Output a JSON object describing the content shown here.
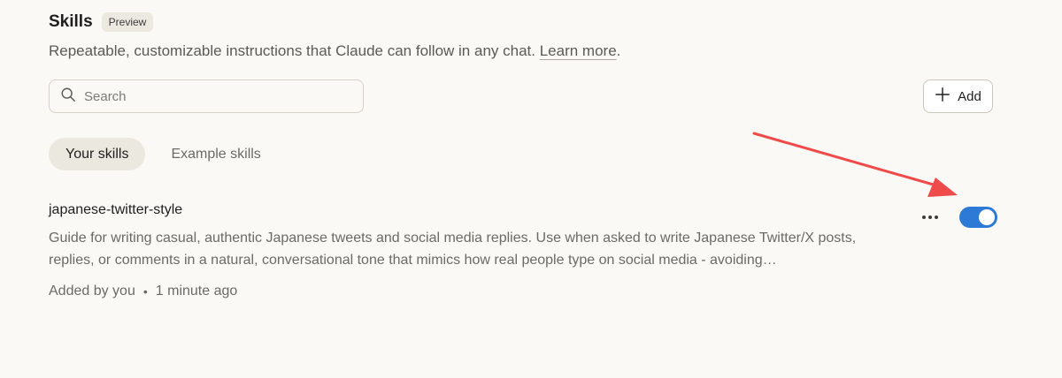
{
  "header": {
    "title": "Skills",
    "badge": "Preview",
    "subtitle": "Repeatable, customizable instructions that Claude can follow in any chat.",
    "learn_more": "Learn more",
    "subtitle_suffix": "."
  },
  "search": {
    "placeholder": "Search",
    "value": ""
  },
  "add_button": {
    "label": "Add",
    "icon": "plus-icon"
  },
  "tabs": [
    {
      "label": "Your skills",
      "active": true
    },
    {
      "label": "Example skills",
      "active": false
    }
  ],
  "skills": [
    {
      "name": "japanese-twitter-style",
      "description": "Guide for writing casual, authentic Japanese tweets and social media replies. Use when asked to write Japanese Twitter/X posts, replies, or comments in a natural, conversational tone that mimics how real people type on social media - avoiding…",
      "added_by": "Added by you",
      "separator": "•",
      "time": "1 minute ago",
      "enabled": true
    }
  ],
  "colors": {
    "background": "#faf9f5",
    "toggle_on": "#2d7ad6",
    "annotation_arrow": "#ef4b4b"
  }
}
